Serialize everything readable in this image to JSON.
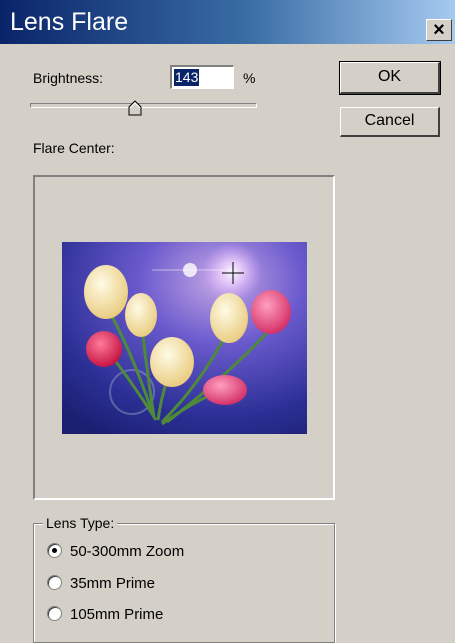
{
  "window": {
    "title": "Lens Flare",
    "close_glyph": "×"
  },
  "brightness": {
    "label": "Brightness:",
    "value": "143",
    "unit": "%",
    "level": 0.52
  },
  "buttons": {
    "ok": "OK",
    "cancel": "Cancel"
  },
  "flare_center": {
    "label": "Flare Center:"
  },
  "lens_type": {
    "label": "Lens Type:",
    "options": [
      {
        "label": "50-300mm Zoom",
        "selected": true
      },
      {
        "label": "35mm Prime",
        "selected": false
      },
      {
        "label": "105mm Prime",
        "selected": false
      }
    ]
  },
  "colors": {
    "title_start": "#0a246a",
    "title_end": "#a6caf0",
    "dialog_bg": "#d4d0c8"
  },
  "icons": {
    "close": "close-icon",
    "crosshair": "crosshair-icon"
  }
}
